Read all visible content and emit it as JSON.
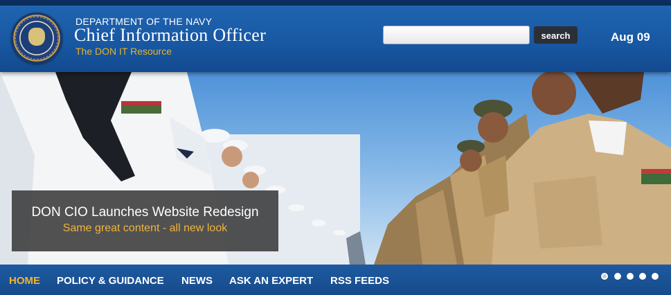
{
  "header": {
    "department": "DEPARTMENT OF THE NAVY",
    "title": "Chief Information Officer",
    "tagline": "The DON IT Resource",
    "seal_icon": "navy-seal-icon"
  },
  "search": {
    "value": "",
    "placeholder": "",
    "button_label": "search"
  },
  "date_display": "Aug 09",
  "hero": {
    "headline": "DON CIO Launches Website Redesign",
    "subheadline": "Same great content - all new look",
    "slide_count": 5,
    "active_slide": 1
  },
  "nav": {
    "items": [
      {
        "label": "HOME",
        "active": true
      },
      {
        "label": "POLICY & GUIDANCE",
        "active": false
      },
      {
        "label": "NEWS",
        "active": false
      },
      {
        "label": "ASK AN EXPERT",
        "active": false
      },
      {
        "label": "RSS FEEDS",
        "active": false
      }
    ]
  },
  "colors": {
    "header_blue": "#1858a3",
    "accent_gold": "#e8b32c",
    "nav_active": "#f2b432",
    "caption_bg": "#3a3a3a"
  }
}
